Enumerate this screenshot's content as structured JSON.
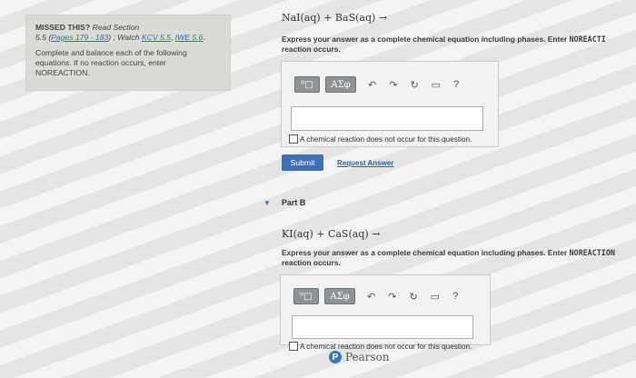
{
  "hint": {
    "missed": "MISSED THIS?",
    "read_section": "Read Section",
    "section_line_prefix": "5.5 (",
    "pages_link": "Pages 179 - 183",
    "watch_sep": ") ; Watch",
    "kcv_link": "KCV 5.5",
    "iwe_link": "IWE 5.6",
    "instructions": "Complete and balance each of the following equations. If no reaction occurs, enter NOREACTION."
  },
  "part_a": {
    "equation": "NaI(aq) + BaS(aq) →",
    "instruction_line1": "Express your answer as a complete chemical equation including phases. Enter",
    "instruction_keyword": "NOREACTI",
    "instruction_line2": "reaction occurs.",
    "toolbar": {
      "templates": "⁰□",
      "greek": "ΑΣφ",
      "undo": "↶",
      "redo": "↷",
      "reset": "↻",
      "keyboard": "▭",
      "help": "?"
    },
    "answer_value": "",
    "no_reaction_label": "A chemical reaction does not occur for this question.",
    "submit_label": "Submit",
    "request_answer_label": "Request Answer"
  },
  "part_b": {
    "title": "Part B",
    "equation": "KI(aq) + CaS(aq) →",
    "instruction_line1": "Express your answer as a complete chemical equation including phases. Enter",
    "instruction_keyword": "NOREACTION",
    "instruction_line2": "reaction occurs.",
    "toolbar": {
      "templates": "⁰□",
      "greek": "ΑΣφ",
      "undo": "↶",
      "redo": "↷",
      "reset": "↻",
      "keyboard": "▭",
      "help": "?"
    },
    "answer_value": "",
    "no_reaction_label": "A chemical reaction does not occur for this question."
  },
  "footer": {
    "brand": "Pearson",
    "logo_letter": "P"
  }
}
